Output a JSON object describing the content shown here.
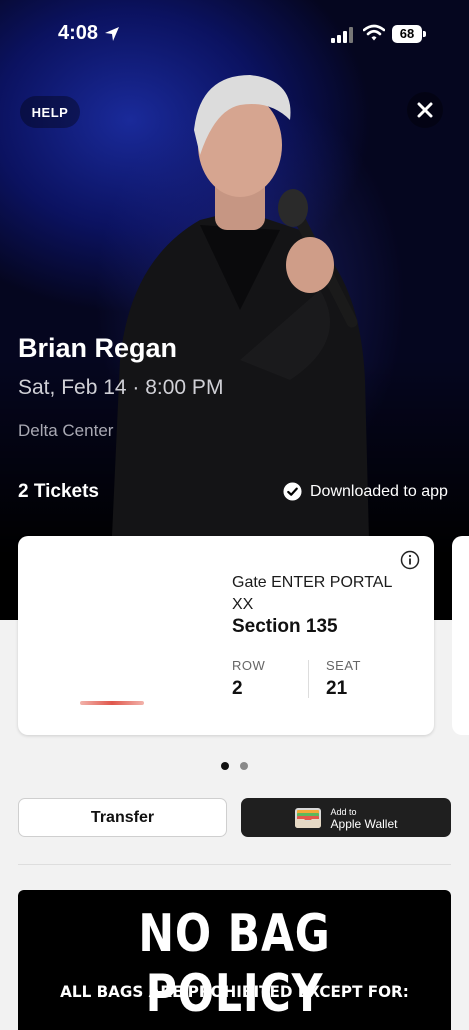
{
  "status_bar": {
    "time": "4:08",
    "battery": "68"
  },
  "header": {
    "help_label": "HELP"
  },
  "event": {
    "title": "Brian Regan",
    "date": "Sat, Feb 14 · 8:00 PM",
    "venue": "Delta Center"
  },
  "tickets": {
    "count_label": "2 Tickets",
    "download_status": "Downloaded to app"
  },
  "ticket_card": {
    "gate": "Gate ENTER PORTAL XX",
    "section": "Section 135",
    "row_label": "ROW",
    "row_value": "2",
    "seat_label": "SEAT",
    "seat_value": "21"
  },
  "pager": {
    "total": 2,
    "active": 1
  },
  "actions": {
    "transfer_label": "Transfer",
    "wallet_small": "Add to",
    "wallet_big": "Apple Wallet"
  },
  "policy": {
    "title": "NO BAG POLICY",
    "subtitle": "ALL BAGS ARE PROHIBITED EXCEPT FOR:"
  },
  "icons": [
    "location-arrow-icon",
    "cellular-signal-icon",
    "wifi-icon",
    "close-icon",
    "check-circle-icon",
    "info-icon",
    "wallet-icon"
  ]
}
